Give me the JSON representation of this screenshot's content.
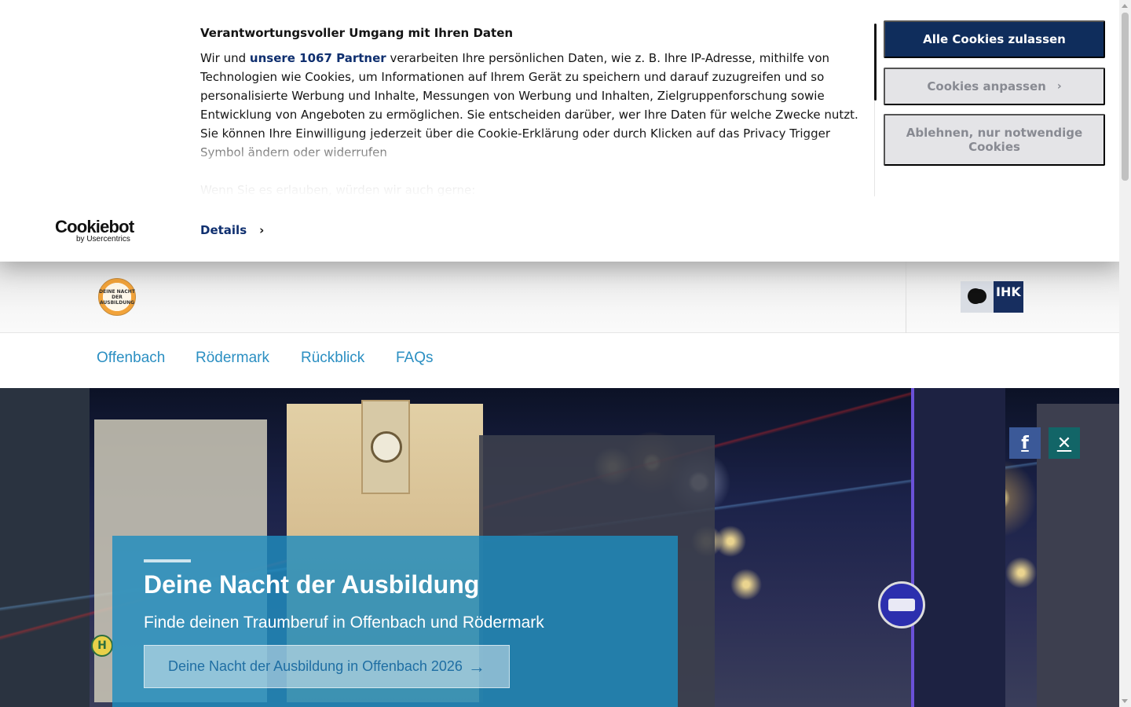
{
  "cookie_banner": {
    "title": "Verantwortungsvoller Umgang mit Ihren Daten",
    "body_intro": "Wir und ",
    "partners_link": "unsere 1067 Partner",
    "body_main": " verarbeiten Ihre persönlichen Daten, wie z. B. Ihre IP-Adresse, mithilfe von Technologien wie Cookies, um Informationen auf Ihrem Gerät zu speichern und darauf zuzugreifen und so personalisierte Werbung und Inhalte, Messungen von Werbung und Inhalten, Zielgruppenforschung sowie Entwicklung von Angeboten zu ermöglichen. Sie entscheiden darüber, wer Ihre Daten für welche Zwecke nutzt. Sie können Ihre Einwilligung jederzeit über die Cookie-Erklärung oder durch Klicken auf das Privacy Trigger Symbol ändern oder widerrufen",
    "body_more": "Wenn Sie es erlauben, würden wir auch gerne:",
    "allow_all": "Alle Cookies zulassen",
    "customize": "Cookies anpassen",
    "deny": "Ablehnen, nur notwendige Cookies",
    "details": "Details",
    "brand_name": "Cookiebot",
    "brand_by": "by Usercentrics",
    "accent_color": "#0f2d5c"
  },
  "header": {
    "logo_text": "DEINE NACHT DER AUSBILDUNG",
    "ihk_text": "IHK"
  },
  "nav": {
    "items": [
      "Offenbach",
      "Rödermark",
      "Rückblick",
      "FAQs"
    ],
    "link_color": "#2b8fc2"
  },
  "hero": {
    "title": "Deine Nacht der Ausbildung",
    "subtitle": "Finde deinen Traumberuf in Offenbach und Rödermark",
    "cta": "Deine Nacht der Ausbildung in Offenbach 2026",
    "cta_icon": "arrow-right-icon",
    "social": [
      "facebook-icon",
      "xing-icon"
    ],
    "sign_h": "H"
  }
}
